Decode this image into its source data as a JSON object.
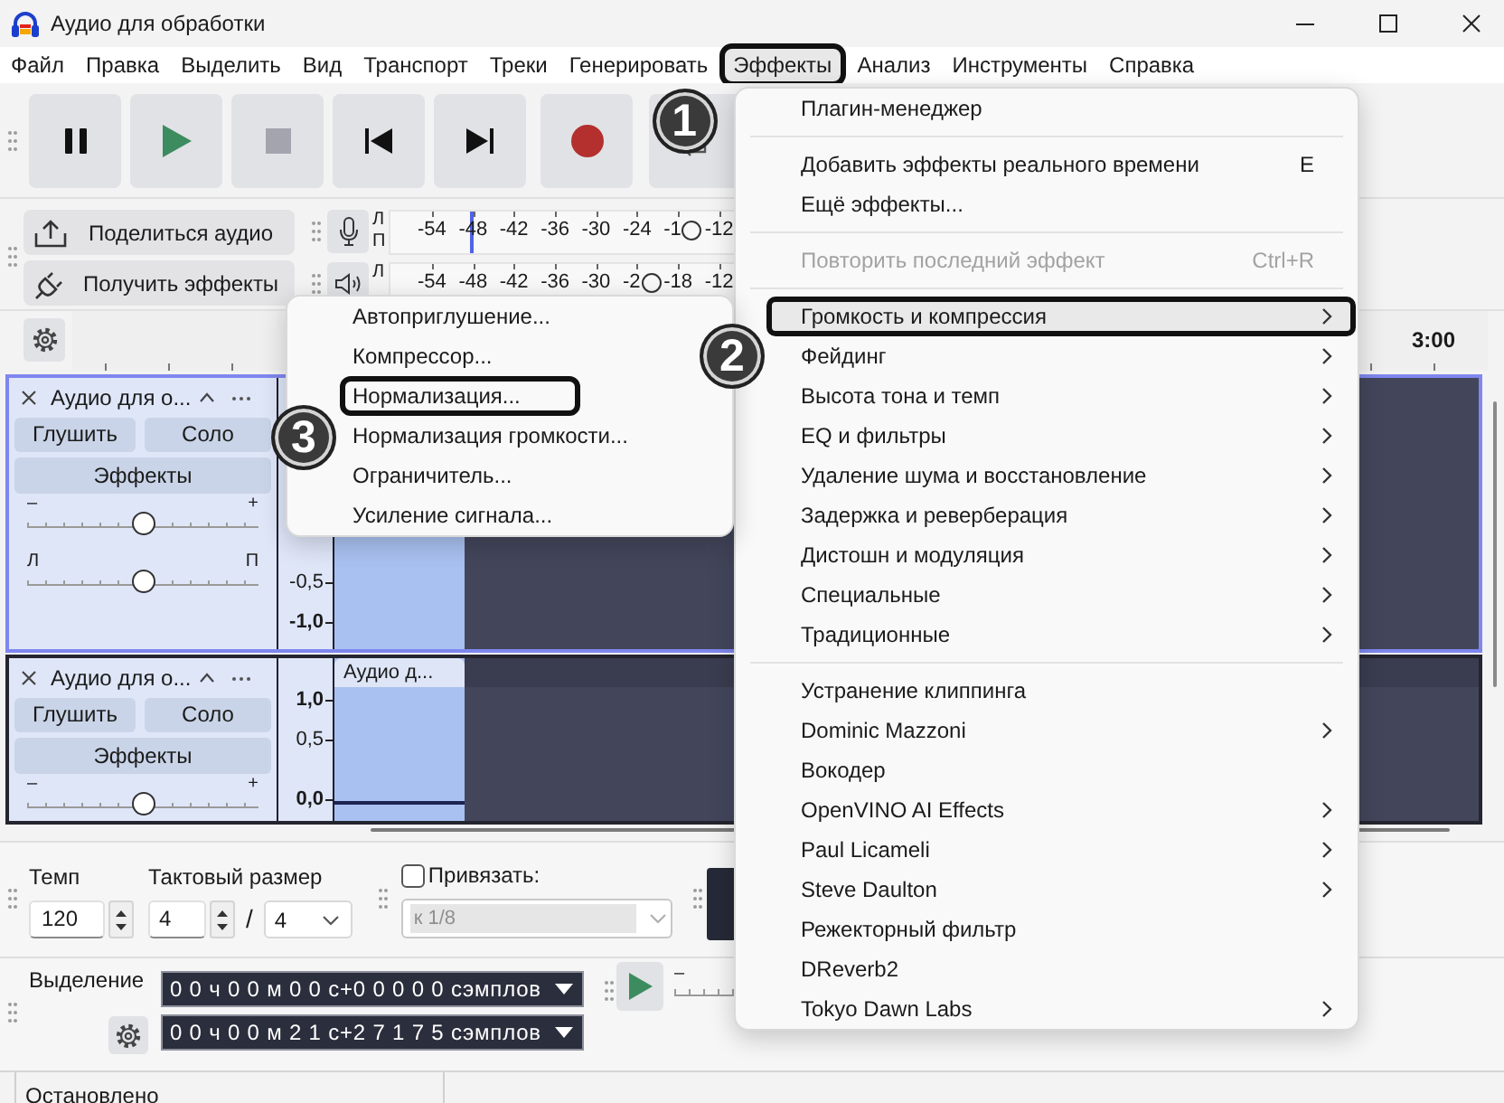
{
  "window": {
    "title": "Аудио для обработки"
  },
  "menu_bar": [
    {
      "label": "Файл",
      "selected": false
    },
    {
      "label": "Правка",
      "selected": false
    },
    {
      "label": "Выделить",
      "selected": false
    },
    {
      "label": "Вид",
      "selected": false
    },
    {
      "label": "Транспорт",
      "selected": false
    },
    {
      "label": "Треки",
      "selected": false
    },
    {
      "label": "Генерировать",
      "selected": false
    },
    {
      "label": "Эффекты",
      "selected": true,
      "callout": "1"
    },
    {
      "label": "Анализ",
      "selected": false
    },
    {
      "label": "Инструменты",
      "selected": false
    },
    {
      "label": "Справка",
      "selected": false
    }
  ],
  "share_toolbar": [
    {
      "label": "Поделиться аудио"
    },
    {
      "label": "Получить эффекты"
    }
  ],
  "meters": [
    {
      "channels": [
        "Л",
        "П"
      ],
      "ticks": [
        "-54",
        "-48",
        "-42",
        "-36",
        "-30",
        "-24",
        "-1",
        "-12"
      ],
      "peak": {
        "level": 0.22
      },
      "slider": {
        "level": 0.82
      }
    },
    {
      "channels": [
        "Л"
      ],
      "ticks": [
        "-54",
        "-48",
        "-42",
        "-36",
        "-30",
        "-2",
        "-18",
        "-12"
      ],
      "slider": {
        "level": 0.71
      }
    }
  ],
  "ruler": {
    "labels": [
      "3:00"
    ]
  },
  "tracks": [
    {
      "name": "Аудио для о...",
      "selected": true,
      "mute": "Глушить",
      "solo": "Соло",
      "effects": "Эффекты",
      "gain": {
        "minus": "–",
        "plus": "+",
        "level": 0.5
      },
      "pan": {
        "left": "Л",
        "right": "П",
        "level": 0.5
      },
      "scale": {
        "minus_half": "-0,5",
        "minus_one": "-1,0"
      }
    },
    {
      "name": "Аудио для о...",
      "selected": false,
      "mute": "Глушить",
      "solo": "Соло",
      "effects": "Эффекты",
      "gain": {
        "minus": "–",
        "plus": "+",
        "level": 0.5
      },
      "clip_title": "Аудио д...",
      "scale": {
        "plus_one": "1,0",
        "plus_half": "0,5",
        "zero": "0,0"
      }
    }
  ],
  "time_signature": {
    "tempo_label": "Темп",
    "tempo": "120",
    "signature_label": "Тактовый размер",
    "beats": "4",
    "separator": "/",
    "unit": "4"
  },
  "snap": {
    "label": "Привязать:",
    "checked": false,
    "value": "к 1/8",
    "disabled": true
  },
  "selection": {
    "label": "Выделение",
    "start": "0 0 ч 0 0 м 0 0 с+0 0 0 0 0 сэмплов",
    "end": "0 0 ч 0 0 м 2 1 с+2 7 1 7 5 сэмплов"
  },
  "play_at_speed": {
    "minus": "–"
  },
  "status_bar": {
    "text": "Остановлено"
  },
  "effects_menu": {
    "items": [
      {
        "kind": "item",
        "label": "Плагин-менеджер",
        "selected": false,
        "disabled": false
      },
      {
        "kind": "separator"
      },
      {
        "kind": "item",
        "label": "Добавить эффекты реального времени",
        "shortcut": "E",
        "selected": false,
        "disabled": false
      },
      {
        "kind": "item",
        "label": "Ещё эффекты...",
        "selected": false,
        "disabled": false
      },
      {
        "kind": "separator"
      },
      {
        "kind": "item",
        "label": "Повторить последний эффект",
        "shortcut": "Ctrl+R",
        "selected": false,
        "disabled": true
      },
      {
        "kind": "separator"
      },
      {
        "kind": "submenu",
        "label": "Громкость и компрессия",
        "selected": true,
        "disabled": false,
        "callout": "2"
      },
      {
        "kind": "submenu",
        "label": "Фейдинг",
        "selected": false,
        "disabled": false
      },
      {
        "kind": "submenu",
        "label": "Высота тона и темп",
        "selected": false,
        "disabled": false
      },
      {
        "kind": "submenu",
        "label": "EQ и фильтры",
        "selected": false,
        "disabled": false
      },
      {
        "kind": "submenu",
        "label": "Удаление шума и восстановление",
        "selected": false,
        "disabled": false
      },
      {
        "kind": "submenu",
        "label": "Задержка и реверберация",
        "selected": false,
        "disabled": false
      },
      {
        "kind": "submenu",
        "label": "Дистошн и модуляция",
        "selected": false,
        "disabled": false
      },
      {
        "kind": "submenu",
        "label": "Специальные",
        "selected": false,
        "disabled": false
      },
      {
        "kind": "submenu",
        "label": "Традиционные",
        "selected": false,
        "disabled": false
      },
      {
        "kind": "separator"
      },
      {
        "kind": "item",
        "label": "Устранение клиппинга",
        "selected": false,
        "disabled": false
      },
      {
        "kind": "submenu",
        "label": "Dominic Mazzoni",
        "selected": false,
        "disabled": false
      },
      {
        "kind": "item",
        "label": "Вокодер",
        "selected": false,
        "disabled": false
      },
      {
        "kind": "submenu",
        "label": "OpenVINO AI Effects",
        "selected": false,
        "disabled": false
      },
      {
        "kind": "submenu",
        "label": "Paul Licameli",
        "selected": false,
        "disabled": false
      },
      {
        "kind": "submenu",
        "label": "Steve Daulton",
        "selected": false,
        "disabled": false
      },
      {
        "kind": "item",
        "label": "Режекторный фильтр",
        "selected": false,
        "disabled": false
      },
      {
        "kind": "item",
        "label": "DReverb2",
        "selected": false,
        "disabled": false
      },
      {
        "kind": "submenu",
        "label": "Tokyo Dawn Labs",
        "selected": false,
        "disabled": false
      }
    ]
  },
  "volume_submenu": {
    "items": [
      {
        "label": "Автоприглушение...",
        "selected": false
      },
      {
        "label": "Компрессор...",
        "selected": false
      },
      {
        "label": "Нормализация...",
        "selected": false,
        "callout": "3"
      },
      {
        "label": "Нормализация громкости...",
        "selected": false
      },
      {
        "label": "Ограничитель...",
        "selected": false
      },
      {
        "label": "Усиление сигнала...",
        "selected": false
      }
    ]
  }
}
